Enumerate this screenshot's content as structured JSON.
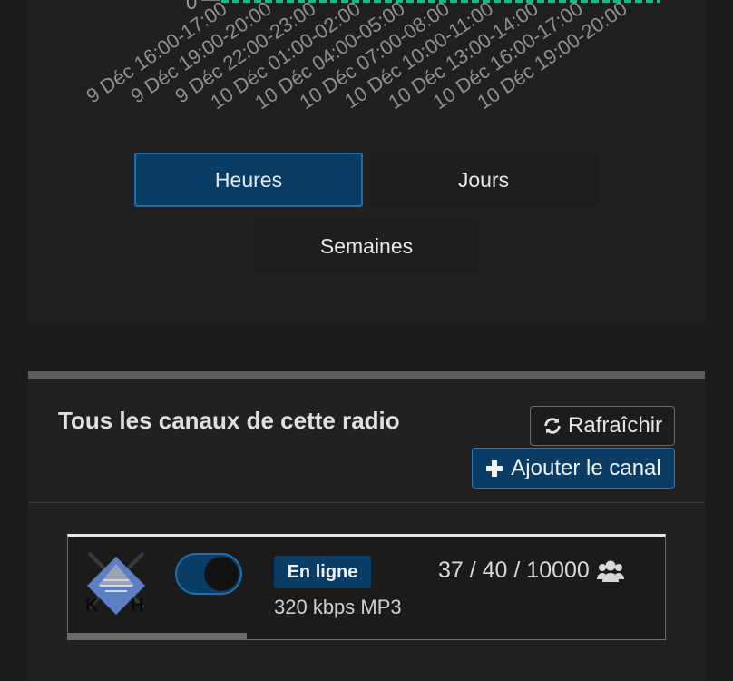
{
  "chart_data": {
    "type": "bar",
    "y_zero_label": "0",
    "categories": [
      "9 Déc 16:00-17:00",
      "9 Déc 19:00-20:00",
      "9 Déc 22:00-23:00",
      "10 Déc 01:00-02:00",
      "10 Déc 04:00-05:00",
      "10 Déc 07:00-08:00",
      "10 Déc 10:00-11:00",
      "10 Déc 13:00-14:00",
      "10 Déc 16:00-17:00",
      "10 Déc 19:00-20:00"
    ],
    "bar_color": "#23b38b"
  },
  "range_buttons": {
    "hours": "Heures",
    "days": "Jours",
    "weeks": "Semaines",
    "active": "hours"
  },
  "channels": {
    "title": "Tous les canaux de cette radio",
    "refresh_label": "Rafraîchir",
    "add_label": "Ajouter le canal",
    "card": {
      "status": "En ligne",
      "bitrate": "320 kbps MP3",
      "listeners": "37 / 40 / 10000",
      "logo_letters": "KH",
      "enabled": true
    }
  },
  "colors": {
    "accent": "#0a3d66",
    "accent_border": "#1d6fad",
    "bar": "#23b38b"
  }
}
